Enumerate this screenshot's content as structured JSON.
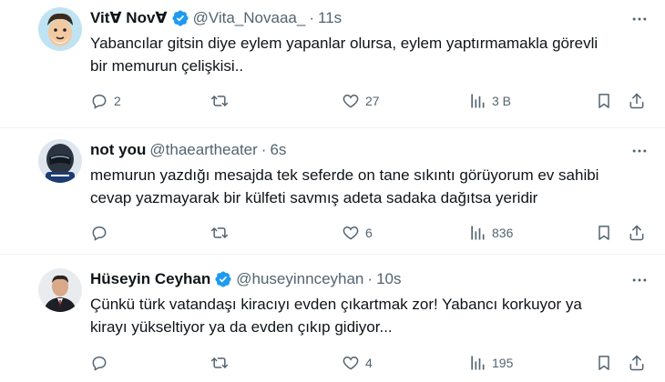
{
  "colors": {
    "text": "#0f1419",
    "secondary": "#536471",
    "verified": "#1d9bf0",
    "divider": "#eff3f4"
  },
  "tweets": [
    {
      "name": "Vit∀ Nov∀",
      "handle": "@Vita_Novaaa_",
      "time": "11s",
      "verified": true,
      "text_lines": [
        "Yabancılar gitsin diye eylem yapanlar olursa, eylem yaptırmamakla görevli",
        "bir memurun çelişkisi.."
      ],
      "replies": "2",
      "retweets": "",
      "likes": "27",
      "views": "3 B",
      "avatar_icon": "cartoon-avatar-icon"
    },
    {
      "name": "not you",
      "handle": "@thaeartheater",
      "time": "6s",
      "verified": false,
      "text_lines": [
        "memurun yazdığı mesajda tek seferde on tane sıkıntı görüyorum ev sahibi",
        "cevap yazmayarak bir külfeti savmış adeta sadaka dağıtsa yeridir"
      ],
      "replies": "",
      "retweets": "",
      "likes": "6",
      "views": "836",
      "avatar_icon": "helmet-avatar-icon"
    },
    {
      "name": "Hüseyin Ceyhan",
      "handle": "@huseyinnceyhan",
      "time": "10s",
      "verified": true,
      "text_lines": [
        "Çünkü türk vatandaşı kiracıyı evden çıkartmak zor! Yabancı korkuyor ya",
        "kirayı yükseltiyor ya da evden çıkıp gidiyor..."
      ],
      "replies": "",
      "retweets": "",
      "likes": "4",
      "views": "195",
      "avatar_icon": "person-avatar-icon"
    }
  ]
}
